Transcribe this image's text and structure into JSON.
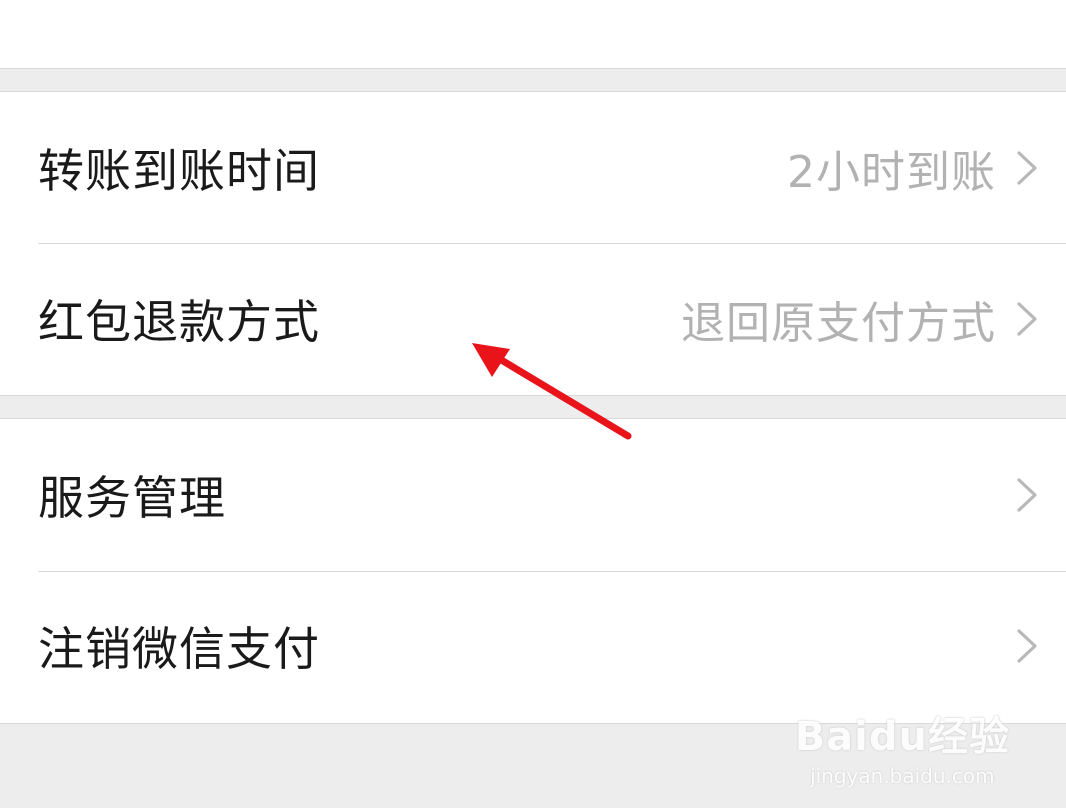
{
  "settings": {
    "group1": [
      {
        "label": "转账到账时间",
        "value": "2小时到账"
      },
      {
        "label": "红包退款方式",
        "value": "退回原支付方式"
      }
    ],
    "group2": [
      {
        "label": "服务管理",
        "value": ""
      },
      {
        "label": "注销微信支付",
        "value": ""
      }
    ]
  },
  "annotation": {
    "color": "#e8141a"
  },
  "watermark": {
    "logo": "Baidu经验",
    "url": "jingyan.baidu.com"
  }
}
